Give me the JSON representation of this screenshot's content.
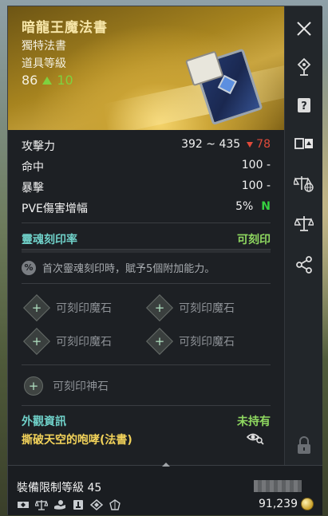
{
  "item": {
    "name": "暗龍王魔法書",
    "type": "獨特法書",
    "level_label": "道具等級",
    "level": "86",
    "level_up": "10"
  },
  "stats": [
    {
      "label": "攻擊力",
      "value": "392 ~ 435",
      "delta": "78"
    },
    {
      "label": "命中",
      "value": "100 -"
    },
    {
      "label": "暴擊",
      "value": "100 -"
    },
    {
      "label": "PVE傷害增幅",
      "value": "5%",
      "badge": "N"
    }
  ],
  "soul": {
    "label": "靈魂刻印率",
    "status": "可刻印",
    "hint": "首次靈魂刻印時，賦予5個附加能力。",
    "hint_icon": "%"
  },
  "slots": {
    "manastone": [
      "可刻印魔石",
      "可刻印魔石",
      "可刻印魔石",
      "可刻印魔石"
    ],
    "godstone": "可刻印神石"
  },
  "appearance": {
    "label": "外觀資訊",
    "status": "未持有",
    "name": "撕破天空的咆哮(法書)"
  },
  "footer": {
    "req_level": "裝備限制等級 45",
    "price": "91,239"
  },
  "colors": {
    "accent_teal": "#6fd0c8",
    "accent_green": "#8fd860",
    "title_gold": "#f7e6a8",
    "decrease_red": "#e04a3a"
  },
  "icons": {
    "sidebar": [
      "close-icon",
      "location-pin-icon",
      "help-scroll-icon",
      "compare-icon",
      "balance-globe-icon",
      "balance-scale-icon",
      "share-icon",
      "lock-icon"
    ],
    "footer": [
      "trade-icon",
      "scale-icon",
      "hand-icon",
      "storage-icon",
      "diamond-icon",
      "crystal-icon"
    ]
  }
}
